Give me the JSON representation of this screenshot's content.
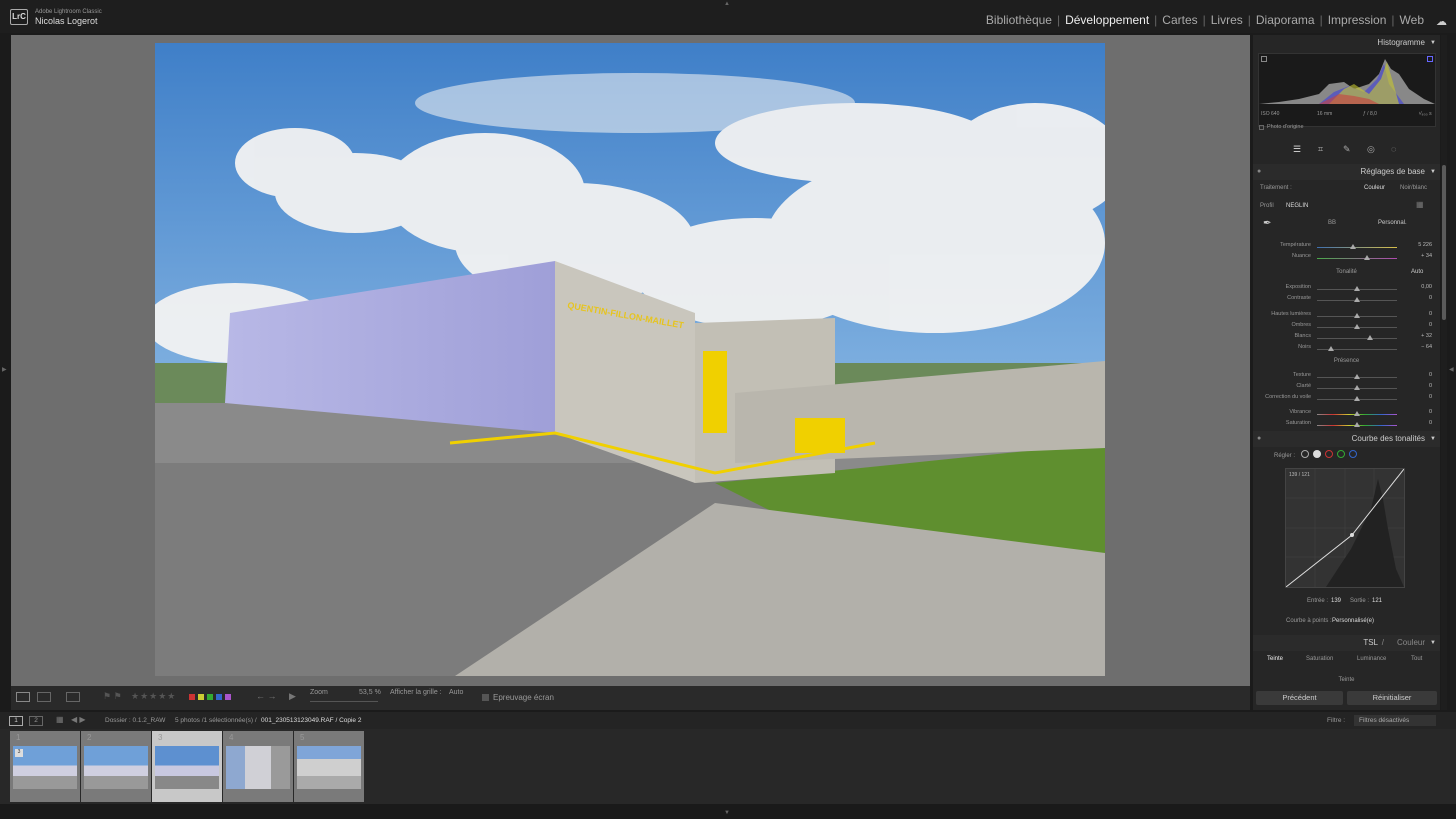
{
  "app": {
    "brand_line1": "Adobe Lightroom Classic",
    "brand_line2": "Nicolas Logerot",
    "logo": "LrC"
  },
  "modules": [
    {
      "label": "Bibliothèque",
      "active": false
    },
    {
      "label": "Développement",
      "active": true
    },
    {
      "label": "Cartes",
      "active": false
    },
    {
      "label": "Livres",
      "active": false
    },
    {
      "label": "Diaporama",
      "active": false
    },
    {
      "label": "Impression",
      "active": false
    },
    {
      "label": "Web",
      "active": false
    }
  ],
  "photo": {
    "sign_text": "QUENTIN-FILLON-MAILLET"
  },
  "toolbar": {
    "zoom_label": "Zoom",
    "zoom_value": "53,5 %",
    "grid_label": "Afficher la grille :",
    "grid_value": "Auto",
    "softproof_label": "Epreuvage écran"
  },
  "histogram": {
    "title": "Histogramme",
    "iso": "ISO 640",
    "focal": "16 mm",
    "aperture": "ƒ / 8,0",
    "shutter": "¹⁄₈₀₀ s",
    "original_label": "Photo d'origine"
  },
  "basic": {
    "title": "Réglages de base",
    "treatment_label": "Traitement :",
    "color_label": "Couleur",
    "bw_label": "Noir/blanc",
    "profile_label": "Profil",
    "profile_value": "NEGLIN",
    "wb_label": "BB",
    "wb_value": "Personnal.",
    "temp": {
      "label": "Température",
      "value": "5 226",
      "pos": 0.45
    },
    "tint": {
      "label": "Nuance",
      "value": "+ 34",
      "pos": 0.62
    },
    "tone_label": "Tonalité",
    "auto_label": "Auto",
    "tone": [
      {
        "label": "Exposition",
        "value": "0,00",
        "pos": 0.5
      },
      {
        "label": "Contraste",
        "value": "0",
        "pos": 0.5
      },
      {
        "label": "Hautes lumières",
        "value": "0",
        "pos": 0.5
      },
      {
        "label": "Ombres",
        "value": "0",
        "pos": 0.5
      },
      {
        "label": "Blancs",
        "value": "+ 32",
        "pos": 0.66
      },
      {
        "label": "Noirs",
        "value": "− 64",
        "pos": 0.18
      }
    ],
    "presence_label": "Présence",
    "presence": [
      {
        "label": "Texture",
        "value": "0",
        "pos": 0.5
      },
      {
        "label": "Clarté",
        "value": "0",
        "pos": 0.5
      },
      {
        "label": "Correction du voile",
        "value": "0",
        "pos": 0.5
      },
      {
        "label": "Vibrance",
        "value": "0",
        "pos": 0.5
      },
      {
        "label": "Saturation",
        "value": "0",
        "pos": 0.5
      }
    ]
  },
  "curve": {
    "title": "Courbe des tonalités",
    "adjust_label": "Régler :",
    "readout": "139 / 121",
    "input_label": "Entrée :",
    "input_value": "139",
    "output_label": "Sortie :",
    "output_value": "121",
    "point_curve_label": "Courbe à points :",
    "point_curve_value": "Personnalisé(e)"
  },
  "hsl": {
    "title": "TSL",
    "title2": "Couleur",
    "tabs": [
      "Teinte",
      "Saturation",
      "Luminance",
      "Tout"
    ],
    "sub": "Teinte"
  },
  "buttons": {
    "previous": "Précédent",
    "reset": "Réinitialiser"
  },
  "filmstrip": {
    "folder": "Dossier : 0.1.2_RAW",
    "count": "5 photos /1 sélectionnée(s) /",
    "file": "001_230513123049.RAF / Copie 2",
    "filter_label": "Filtre :",
    "filter_value": "Filtres désactivés",
    "page1": "1",
    "page2": "2",
    "numbers": [
      "1",
      "2",
      "3",
      "4",
      "5"
    ],
    "badge": "3"
  },
  "colors": {
    "accent": "#eeeeee",
    "panel": "#262626",
    "viewer": "#6e6e6e"
  }
}
